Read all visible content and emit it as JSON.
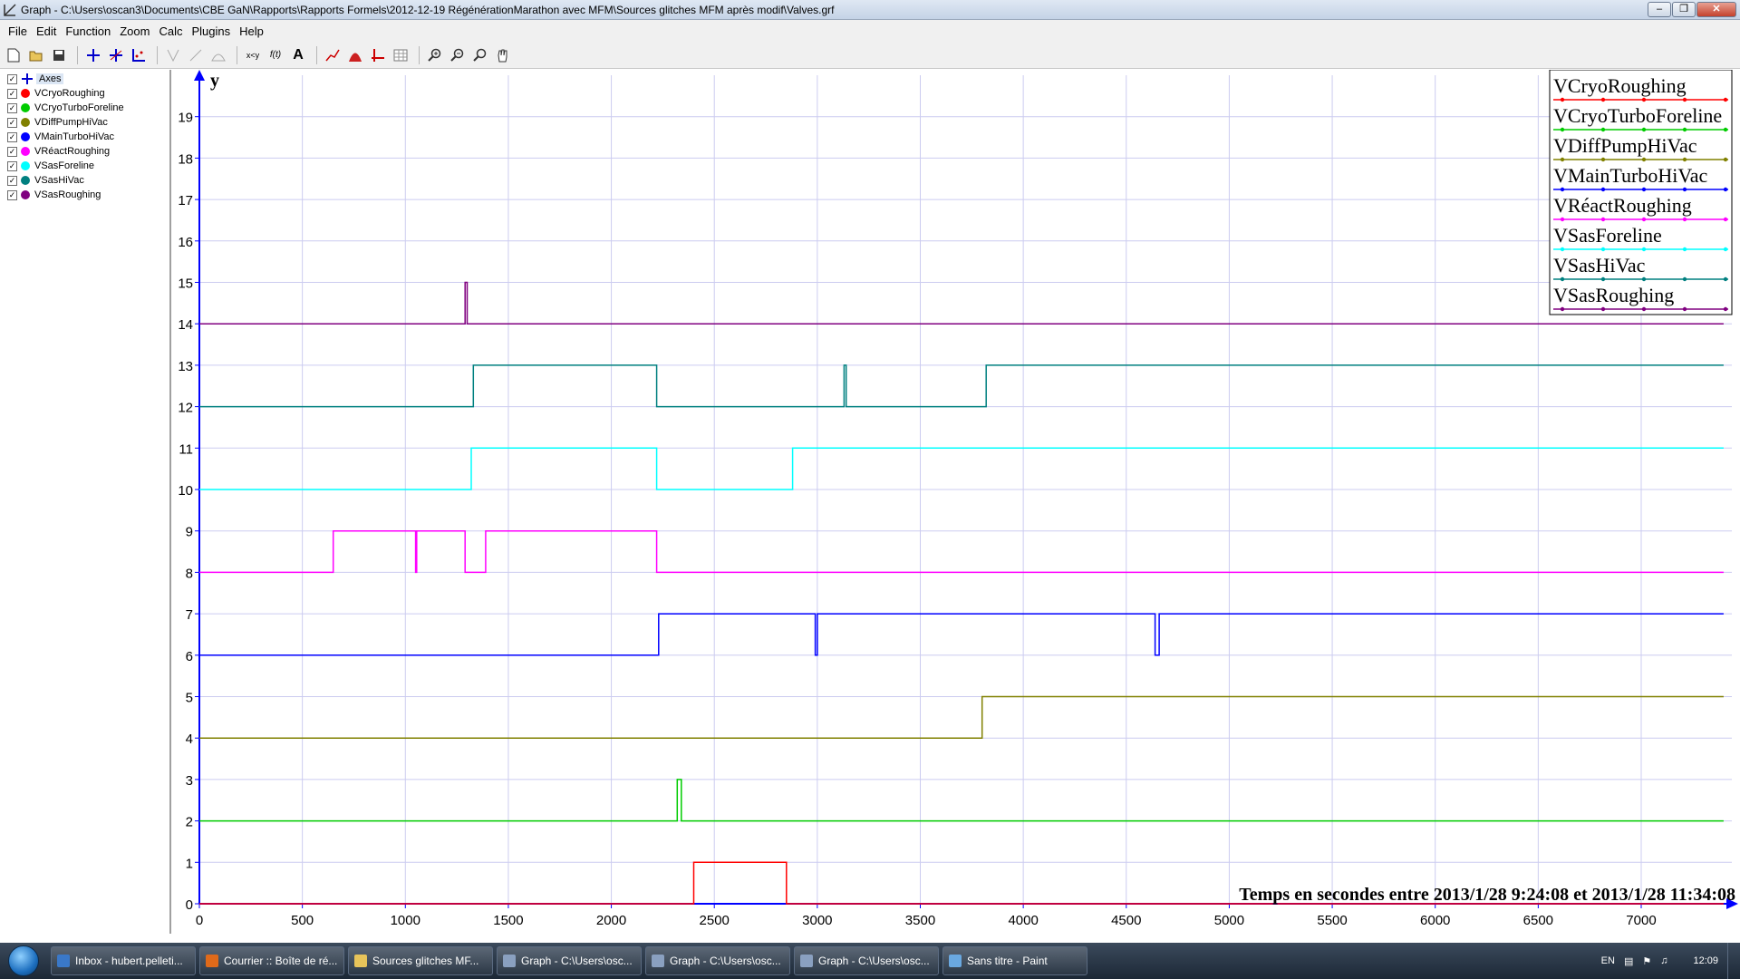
{
  "window": {
    "title": "Graph - C:\\Users\\oscan3\\Documents\\CBE GaN\\Rapports\\Rapports Formels\\2012-12-19 RégénérationMarathon avec MFM\\Sources glitches MFM après modif\\Valves.grf"
  },
  "menu": [
    {
      "key": "file",
      "label": "File"
    },
    {
      "key": "edit",
      "label": "Edit"
    },
    {
      "key": "function",
      "label": "Function"
    },
    {
      "key": "zoom",
      "label": "Zoom"
    },
    {
      "key": "calc",
      "label": "Calc"
    },
    {
      "key": "plugins",
      "label": "Plugins"
    },
    {
      "key": "help",
      "label": "Help"
    }
  ],
  "toolbar": {
    "xy_label": "x<y",
    "fx_label": "f(t)",
    "text_label": "A"
  },
  "sidebar": {
    "axes_label": "Axes",
    "items": [
      {
        "label": "VCryoRoughing",
        "color": "#ff0000"
      },
      {
        "label": "VCryoTurboForeline",
        "color": "#00cc00"
      },
      {
        "label": "VDiffPumpHiVac",
        "color": "#808000"
      },
      {
        "label": "VMainTurboHiVac",
        "color": "#0000ff"
      },
      {
        "label": "VRéactRoughing",
        "color": "#ff00ff"
      },
      {
        "label": "VSasForeline",
        "color": "#00ffff"
      },
      {
        "label": "VSasHiVac",
        "color": "#008080"
      },
      {
        "label": "VSasRoughing",
        "color": "#800080"
      }
    ]
  },
  "chart_data": {
    "type": "line",
    "ylabel": "y",
    "xlabel": "Temps en secondes entre 2013/1/28 9:24:08 et 2013/1/28 11:34:08",
    "xlim": [
      0,
      7440
    ],
    "ylim": [
      0,
      20
    ],
    "xticks": [
      0,
      500,
      1000,
      1500,
      2000,
      2500,
      3000,
      3500,
      4000,
      4500,
      5000,
      5500,
      6000,
      6500,
      7000
    ],
    "yticks": [
      0,
      1,
      2,
      3,
      4,
      5,
      6,
      7,
      8,
      9,
      10,
      11,
      12,
      13,
      14,
      15,
      16,
      17,
      18,
      19
    ],
    "grid": true,
    "legend": "top-right",
    "series": [
      {
        "name": "VCryoRoughing",
        "color": "#ff0000",
        "x": [
          0,
          2400,
          2400,
          2850,
          2850,
          7400
        ],
        "y": [
          0,
          0,
          1,
          1,
          0,
          0
        ]
      },
      {
        "name": "VCryoTurboForeline",
        "color": "#00cc00",
        "x": [
          0,
          2320,
          2320,
          2340,
          2340,
          7400
        ],
        "y": [
          2,
          2,
          3,
          3,
          2,
          2
        ]
      },
      {
        "name": "VDiffPumpHiVac",
        "color": "#808000",
        "x": [
          0,
          3800,
          3800,
          7400
        ],
        "y": [
          4,
          4,
          5,
          5
        ]
      },
      {
        "name": "VMainTurboHiVac",
        "color": "#0000ff",
        "x": [
          0,
          2230,
          2230,
          2990,
          2990,
          3000,
          3000,
          4640,
          4640,
          4660,
          4660,
          7400
        ],
        "y": [
          6,
          6,
          7,
          7,
          6,
          6,
          7,
          7,
          6,
          6,
          7,
          7
        ]
      },
      {
        "name": "VRéactRoughing",
        "color": "#ff00ff",
        "x": [
          0,
          650,
          650,
          1050,
          1050,
          1055,
          1055,
          1290,
          1290,
          1390,
          1390,
          2220,
          2220,
          7400
        ],
        "y": [
          8,
          8,
          9,
          9,
          8,
          8,
          9,
          9,
          8,
          8,
          9,
          9,
          8,
          8
        ]
      },
      {
        "name": "VSasForeline",
        "color": "#00ffff",
        "x": [
          0,
          1320,
          1320,
          2220,
          2220,
          2880,
          2880,
          7400
        ],
        "y": [
          10,
          10,
          11,
          11,
          10,
          10,
          11,
          11
        ]
      },
      {
        "name": "VSasHiVac",
        "color": "#008080",
        "x": [
          0,
          1330,
          1330,
          2220,
          2220,
          3130,
          3130,
          3140,
          3140,
          3820,
          3820,
          7400
        ],
        "y": [
          12,
          12,
          13,
          13,
          12,
          12,
          13,
          13,
          12,
          12,
          13,
          13
        ]
      },
      {
        "name": "VSasRoughing",
        "color": "#800080",
        "x": [
          0,
          1290,
          1290,
          1300,
          1300,
          7400
        ],
        "y": [
          14,
          14,
          15,
          15,
          14,
          14
        ]
      }
    ]
  },
  "taskbar": {
    "tasks": [
      {
        "label": "Inbox - hubert.pelleti...",
        "color": "#3a78c8"
      },
      {
        "label": "Courrier :: Boîte de ré...",
        "color": "#e06a1a"
      },
      {
        "label": "Sources glitches MF...",
        "color": "#e8c45a"
      },
      {
        "label": "Graph - C:\\Users\\osc...",
        "color": "#8aa0c0"
      },
      {
        "label": "Graph - C:\\Users\\osc...",
        "color": "#8aa0c0"
      },
      {
        "label": "Graph - C:\\Users\\osc...",
        "color": "#8aa0c0"
      },
      {
        "label": "Sans titre - Paint",
        "color": "#6aa8e0"
      }
    ],
    "lang": "EN",
    "clock": "12:09"
  }
}
